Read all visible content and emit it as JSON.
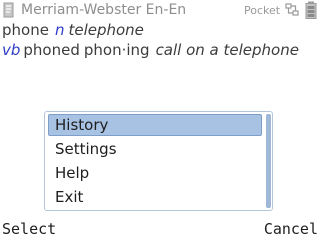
{
  "titlebar": {
    "app_icon": "book-app-icon",
    "title": "Merriam-Webster En-En",
    "mode": "Pocket",
    "connection_icon": "connectivity-icon",
    "battery_icon": "battery-icon"
  },
  "entry": {
    "line1": {
      "word": "phone",
      "pos": "n",
      "gloss": "telephone"
    },
    "line2": {
      "pos": "vb",
      "forms": "phoned",
      "variant": "phon·ing",
      "gloss": "call on a telephone"
    }
  },
  "menu": {
    "items": [
      "History",
      "Settings",
      "Help",
      "Exit"
    ],
    "selected": "History",
    "accent": "#a8c2e4"
  },
  "softkeys": {
    "left": "Select",
    "right": "Cancel"
  },
  "colors": {
    "pos": "#2f3cc9",
    "text": "#3c3c3c",
    "title": "#8e8e8e"
  }
}
